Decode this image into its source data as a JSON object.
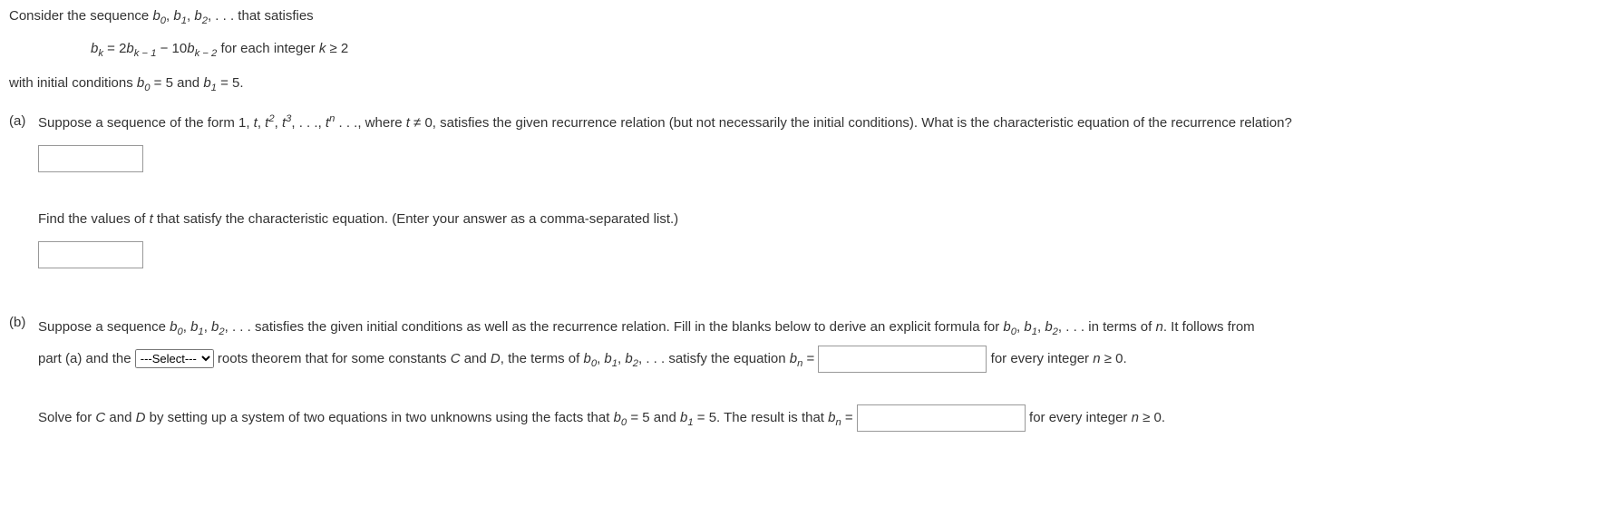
{
  "intro": "Consider the sequence ",
  "seq": "b",
  "sub0": "0",
  "sub1": "1",
  "sub2": "2",
  "dots": ", . . .",
  "that_satisfies": " that satisfies",
  "recur_lhs_b": "b",
  "recur_lhs_sub": "k",
  "recur_eq": " = 2",
  "recur_bk1": "b",
  "recur_bk1_sub": "k − 1",
  "recur_minus": " − 10",
  "recur_bk2": "b",
  "recur_bk2_sub": "k − 2",
  "recur_tail": " for each integer ",
  "recur_k": "k",
  "recur_geq": " ≥ 2",
  "initial_pre": "with initial conditions ",
  "initial_b0": "b",
  "initial_b0_sub": "0",
  "initial_b0_val": " = 5 and ",
  "initial_b1": "b",
  "initial_b1_sub": "1",
  "initial_b1_val": " = 5.",
  "part_a_label": "(a)",
  "part_a_text1": "Suppose a sequence of the form 1, ",
  "part_a_t": "t",
  "part_a_comma": ", ",
  "part_a_t2": "t",
  "part_a_exp2": "2",
  "part_a_t3": "t",
  "part_a_exp3": "3",
  "part_a_dots1": ", . . ., ",
  "part_a_tn": "t",
  "part_a_expn": "n",
  "part_a_dots2": " . . ., where ",
  "part_a_tneq": "t",
  "part_a_neq": " ≠ 0, satisfies the given recurrence relation (but not necessarily the initial conditions). What is the characteristic equation of the recurrence relation?",
  "part_a_find": "Find the values of ",
  "part_a_find_t": "t",
  "part_a_find2": " that satisfy the characteristic equation. (Enter your answer as a comma-separated list.)",
  "part_b_label": "(b)",
  "part_b_text1": "Suppose a sequence ",
  "part_b_satisfies": " satisfies the given initial conditions as well as the recurrence relation. Fill in the blanks below to derive an explicit formula for ",
  "part_b_interms": " in terms of ",
  "part_b_n": "n",
  "part_b_follows": ". It follows from",
  "part_b_line2_pre": "part (a) and the ",
  "select_default": "---Select---",
  "part_b_line2_post": " roots theorem that for some constants ",
  "part_b_C": "C",
  "part_b_and": " and ",
  "part_b_D": "D",
  "part_b_terms": ", the terms of ",
  "part_b_satisfy_eq": " satisfy the equation ",
  "part_b_bn": "b",
  "part_b_bn_sub": "n",
  "part_b_eq": " = ",
  "part_b_for_every": " for every integer ",
  "part_b_ngeq": " ≥ 0.",
  "solve_pre": "Solve for ",
  "solve_C": "C",
  "solve_and": " and ",
  "solve_D": "D",
  "solve_text": " by setting up a system of two equations in two unknowns using the facts that ",
  "solve_b0": "b",
  "solve_b0_sub": "0",
  "solve_b0_val": " = 5 and ",
  "solve_b1": "b",
  "solve_b1_sub": "1",
  "solve_b1_val": " = 5. The result is that ",
  "solve_bn": "b",
  "solve_bn_sub": "n",
  "solve_eq": " = ",
  "solve_for_every": " for every integer ",
  "solve_n": "n",
  "solve_ngeq": " ≥ 0."
}
